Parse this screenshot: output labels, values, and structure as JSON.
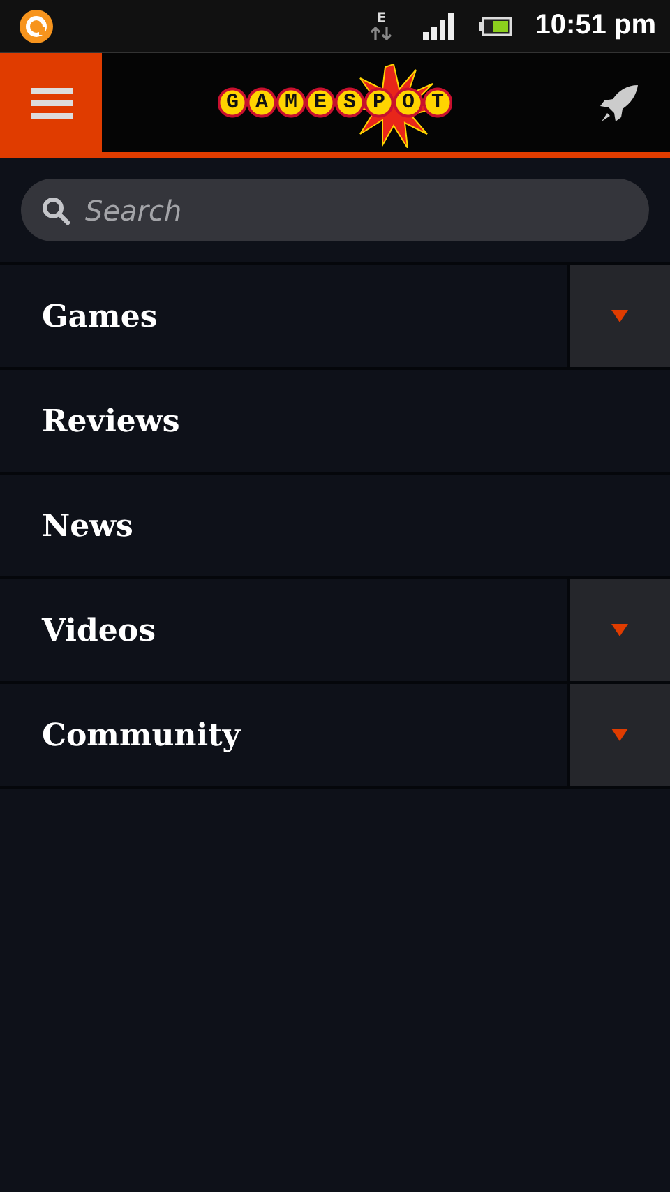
{
  "status_bar": {
    "network": "E",
    "time": "10:51 pm"
  },
  "header": {
    "logo": "GAMESPOT"
  },
  "search": {
    "placeholder": "Search"
  },
  "menu": [
    {
      "label": "Games",
      "expandable": true
    },
    {
      "label": "Reviews",
      "expandable": false
    },
    {
      "label": "News",
      "expandable": false
    },
    {
      "label": "Videos",
      "expandable": true
    },
    {
      "label": "Community",
      "expandable": true
    }
  ]
}
